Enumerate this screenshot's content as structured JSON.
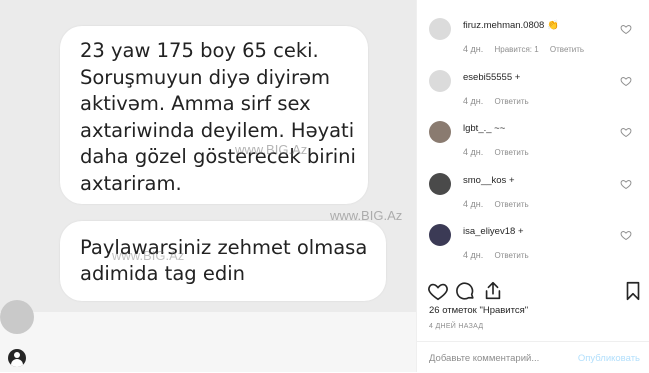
{
  "photo": {
    "message1": "23 yaw 175 boy 65 ceki.\nSoruşmuyun diyə diyirəm\naktivəm. Amma sirf sex\naxtariwinda deyilem. Həyati\ndaha gözel gösterecek birini\naxtariram.",
    "message2": "Paylawarsiniz zehmet olmasa\nadimida tag edin",
    "watermark": "www.BIG.Az"
  },
  "comments": [
    {
      "username": "firuz.mehman.0808",
      "badge": "👏",
      "age": "4 дн.",
      "likes": "Нравится: 1",
      "reply": "Ответить",
      "avatar_color": "#dbdbdb"
    },
    {
      "username": "esebi55555",
      "badge": "+",
      "age": "4 дн.",
      "likes": "",
      "reply": "Ответить",
      "avatar_color": "#dbdbdb"
    },
    {
      "username": "lgbt_._",
      "badge": "~~",
      "age": "4 дн.",
      "likes": "",
      "reply": "Ответить",
      "avatar_color": "#8a7b70"
    },
    {
      "username": "smo__kos",
      "badge": "+",
      "age": "4 дн.",
      "likes": "",
      "reply": "Ответить",
      "avatar_color": "#4a4a4a"
    },
    {
      "username": "isa_eliyev18",
      "badge": "+",
      "age": "4 дн.",
      "likes": "",
      "reply": "Ответить",
      "avatar_color": "#3b3a55"
    }
  ],
  "post": {
    "likes_text": "26 отметок \"Нравится\"",
    "age": "4 ДНЕЙ НАЗАД",
    "comment_placeholder": "Добавьте комментарий...",
    "publish_label": "Опубликовать"
  },
  "icons": {
    "heart": "heart-icon",
    "comment": "comment-icon",
    "share": "share-icon",
    "bookmark": "bookmark-icon",
    "user": "user-icon"
  },
  "colors": {
    "publish_disabled": "#b2dffc",
    "meta_gray": "#8e8e8e"
  }
}
